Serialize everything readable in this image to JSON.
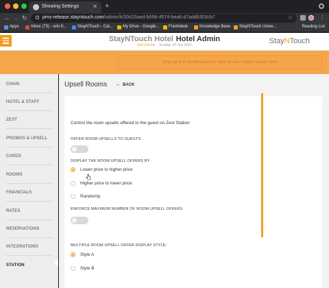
{
  "browser": {
    "tab_title": "Showing Settings",
    "url_host": "pms-release.stayntouch.com",
    "url_path": "/admin/h/20d15aed-b598-4574-bea6-d7addb303cb7",
    "bookmarks": [
      {
        "label": "Apps",
        "color": "#5f8ee6"
      },
      {
        "label": "Inbox (73) - erin.fi...",
        "color": "#d9473b"
      },
      {
        "label": "StayNTouch - Cal...",
        "color": "#4285f4"
      },
      {
        "label": "My Drive - Google...",
        "color": "#f4b400"
      },
      {
        "label": "Freshdesk",
        "color": "#f4b400"
      },
      {
        "label": "Knowledge Base",
        "color": "#f39c25"
      },
      {
        "label": "StayNTouch Unive...",
        "color": "#f39c25"
      }
    ],
    "reading_list": "Reading List"
  },
  "header": {
    "hotel_name": "StayNTouch Hotel",
    "section_title": "Hotel Admin",
    "user_name": "Erin Fischer",
    "date": "Sunday, 20 July 2021",
    "brand_prefix": "Stay",
    "brand_mid": "N",
    "brand_suffix": "Touch"
  },
  "dashboard": {
    "drop_hint": "Drop up to 8 dashboard icons here for your custom quick menu"
  },
  "sidebar": {
    "items": [
      {
        "label": "CHAIN"
      },
      {
        "label": "HOTEL & STAFF"
      },
      {
        "label": "ZEST"
      },
      {
        "label": "PROMOS & UPSELL"
      },
      {
        "label": "CARDS"
      },
      {
        "label": "ROOMS"
      },
      {
        "label": "FINANCIALS"
      },
      {
        "label": "RATES"
      },
      {
        "label": "RESERVATIONS"
      },
      {
        "label": "INTEGRATIONS"
      },
      {
        "label": "STATION"
      }
    ],
    "active": "STATION"
  },
  "page": {
    "title": "Upsell Rooms",
    "back_label": "BACK",
    "description": "Control the room upsells offered to the guest on Zest Station",
    "offer_label": "OFFER ROOM UPSELLS TO GUESTS",
    "offer_enabled": false,
    "display_label": "DISPLAY THE ROOM UPSELL OFFERS BY:",
    "display_options": [
      {
        "label": "Lower price to higher price",
        "selected": true
      },
      {
        "label": "Higher price to lower price",
        "selected": false
      },
      {
        "label": "Randomly",
        "selected": false
      }
    ],
    "enforce_label": "ENFORCE MAXIMUM NUMBER OF ROOM UPSELL OFFERS",
    "enforce_enabled": false,
    "style_label": "MULTIPLE ROOM UPSELL OFFER DISPLAY STYLE:",
    "style_options": [
      {
        "label": "Style A",
        "selected": true
      },
      {
        "label": "Style B",
        "selected": false
      }
    ]
  },
  "colors": {
    "accent": "#f39c25",
    "dashboard_bar": "#f6a64a",
    "sidebar_bg": "#ededed"
  }
}
